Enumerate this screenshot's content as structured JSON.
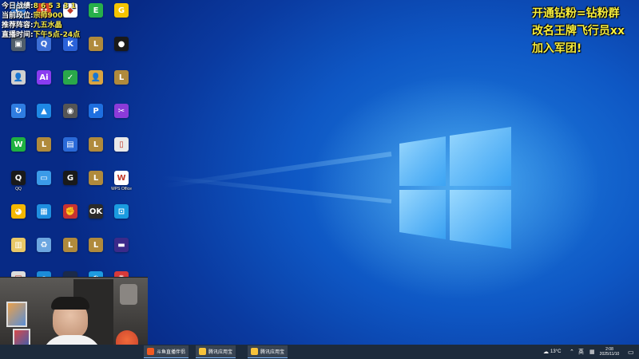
{
  "overlay": {
    "stats": [
      {
        "label": "今日战绩:",
        "value": "8 6 5 3 3 1"
      },
      {
        "label": "当前段位:",
        "value": "宗师900"
      },
      {
        "label": "推荐阵容:",
        "value": "九五水晶"
      },
      {
        "label": "直播时间:",
        "value": "下午5点-24点"
      }
    ],
    "promo": [
      "开通钻粉=钻粉群",
      "改名王牌飞行员xx",
      "加入军团!"
    ]
  },
  "desktop_icons": [
    {
      "label": "",
      "color": "#2f7de1",
      "glyph": "C",
      "icon": "app-icon"
    },
    {
      "label": "",
      "color": "#e84a2a",
      "glyph": "✿",
      "icon": "app-icon"
    },
    {
      "label": "",
      "color": "#ffffff",
      "glyph": "◆",
      "icon": "app-icon"
    },
    {
      "label": "",
      "color": "#27b04a",
      "glyph": "E",
      "icon": "app-icon"
    },
    {
      "label": "",
      "color": "#f5c400",
      "glyph": "G",
      "icon": "app-icon"
    },
    {
      "label": "",
      "color": "#4f5d6b",
      "glyph": "▣",
      "icon": "app-icon"
    },
    {
      "label": "",
      "color": "#3c6fd6",
      "glyph": "Q",
      "icon": "app-icon"
    },
    {
      "label": "",
      "color": "#2b62d9",
      "glyph": "K",
      "icon": "app-icon"
    },
    {
      "label": "",
      "color": "#b08a3c",
      "glyph": "L",
      "icon": "lol-icon"
    },
    {
      "label": "",
      "color": "#1a1a1a",
      "glyph": "●",
      "icon": "app-icon"
    },
    {
      "label": "",
      "color": "#cfcfcf",
      "glyph": "👤",
      "icon": "app-icon"
    },
    {
      "label": "",
      "color": "#8a3cf0",
      "glyph": "Ai",
      "icon": "app-icon"
    },
    {
      "label": "",
      "color": "#2aa84a",
      "glyph": "✓",
      "icon": "app-icon"
    },
    {
      "label": "",
      "color": "#d9a441",
      "glyph": "👤",
      "icon": "app-icon"
    },
    {
      "label": "",
      "color": "#b08a3c",
      "glyph": "L",
      "icon": "lol-icon"
    },
    {
      "label": "",
      "color": "#2f7de1",
      "glyph": "↻",
      "icon": "app-icon"
    },
    {
      "label": "",
      "color": "#1e88e5",
      "glyph": "▲",
      "icon": "app-icon"
    },
    {
      "label": "",
      "color": "#555",
      "glyph": "◉",
      "icon": "app-icon"
    },
    {
      "label": "",
      "color": "#1e6fe0",
      "glyph": "P",
      "icon": "app-icon"
    },
    {
      "label": "",
      "color": "#8b3bd9",
      "glyph": "✂",
      "icon": "app-icon"
    },
    {
      "label": "",
      "color": "#1fb141",
      "glyph": "W",
      "icon": "wechat-icon"
    },
    {
      "label": "",
      "color": "#b08a3c",
      "glyph": "L",
      "icon": "lol-icon"
    },
    {
      "label": "",
      "color": "#2a6ad8",
      "glyph": "▤",
      "icon": "app-icon"
    },
    {
      "label": "",
      "color": "#b08a3c",
      "glyph": "L",
      "icon": "lol-icon"
    },
    {
      "label": "",
      "color": "#e9e9e9",
      "glyph": "▯",
      "icon": "file-icon"
    },
    {
      "label": "QQ",
      "color": "#1a1a1a",
      "glyph": "Q",
      "icon": "qq-icon"
    },
    {
      "label": "",
      "color": "#3b9be8",
      "glyph": "▭",
      "icon": "app-icon"
    },
    {
      "label": "",
      "color": "#1a1a1a",
      "glyph": "G",
      "icon": "app-icon"
    },
    {
      "label": "",
      "color": "#b08a3c",
      "glyph": "L",
      "icon": "lol-icon"
    },
    {
      "label": "WPS Office",
      "color": "#ffffff",
      "glyph": "W",
      "icon": "wps-icon"
    },
    {
      "label": "",
      "color": "#f5b800",
      "glyph": "◕",
      "icon": "app-icon"
    },
    {
      "label": "",
      "color": "#1f8fe0",
      "glyph": "▦",
      "icon": "app-icon"
    },
    {
      "label": "",
      "color": "#c83232",
      "glyph": "✊",
      "icon": "app-icon"
    },
    {
      "label": "",
      "color": "#2a2a2a",
      "glyph": "OK",
      "icon": "app-icon"
    },
    {
      "label": "",
      "color": "#1a9be0",
      "glyph": "⊡",
      "icon": "app-icon"
    },
    {
      "label": "",
      "color": "#e9c766",
      "glyph": "▥",
      "icon": "file-icon"
    },
    {
      "label": "",
      "color": "#6ca6e0",
      "glyph": "♻",
      "icon": "recycle-bin-icon"
    },
    {
      "label": "",
      "color": "#b08a3c",
      "glyph": "L",
      "icon": "lol-icon"
    },
    {
      "label": "",
      "color": "#b08a3c",
      "glyph": "L",
      "icon": "lol-icon"
    },
    {
      "label": "",
      "color": "#3b2a8a",
      "glyph": "▬",
      "icon": "app-icon"
    },
    {
      "label": "",
      "color": "#dcdcdc",
      "glyph": "▤",
      "icon": "app-icon"
    },
    {
      "label": "",
      "color": "#1c8cd8",
      "glyph": "e",
      "icon": "ie-icon"
    },
    {
      "label": "",
      "color": "#1b2a4a",
      "glyph": "▬",
      "icon": "app-icon"
    },
    {
      "label": "",
      "color": "#1e9be0",
      "glyph": "◐",
      "icon": "edge-icon"
    },
    {
      "label": "",
      "color": "#d63a3a",
      "glyph": "✺",
      "icon": "app-icon"
    }
  ],
  "taskbar": {
    "apps": [
      {
        "label": "斗鱼直播伴侣",
        "color": "#f25a20"
      },
      {
        "label": "腾讯应用宝",
        "color": "#f7c33a"
      },
      {
        "label": "腾讯应用宝",
        "color": "#f7c33a"
      }
    ],
    "weather": "13°C",
    "ime": "英",
    "time": "2:08",
    "date": "2025/11/10"
  },
  "colors": {
    "accent": "#f7ee3c",
    "taskbar": "#1d2b3c"
  }
}
